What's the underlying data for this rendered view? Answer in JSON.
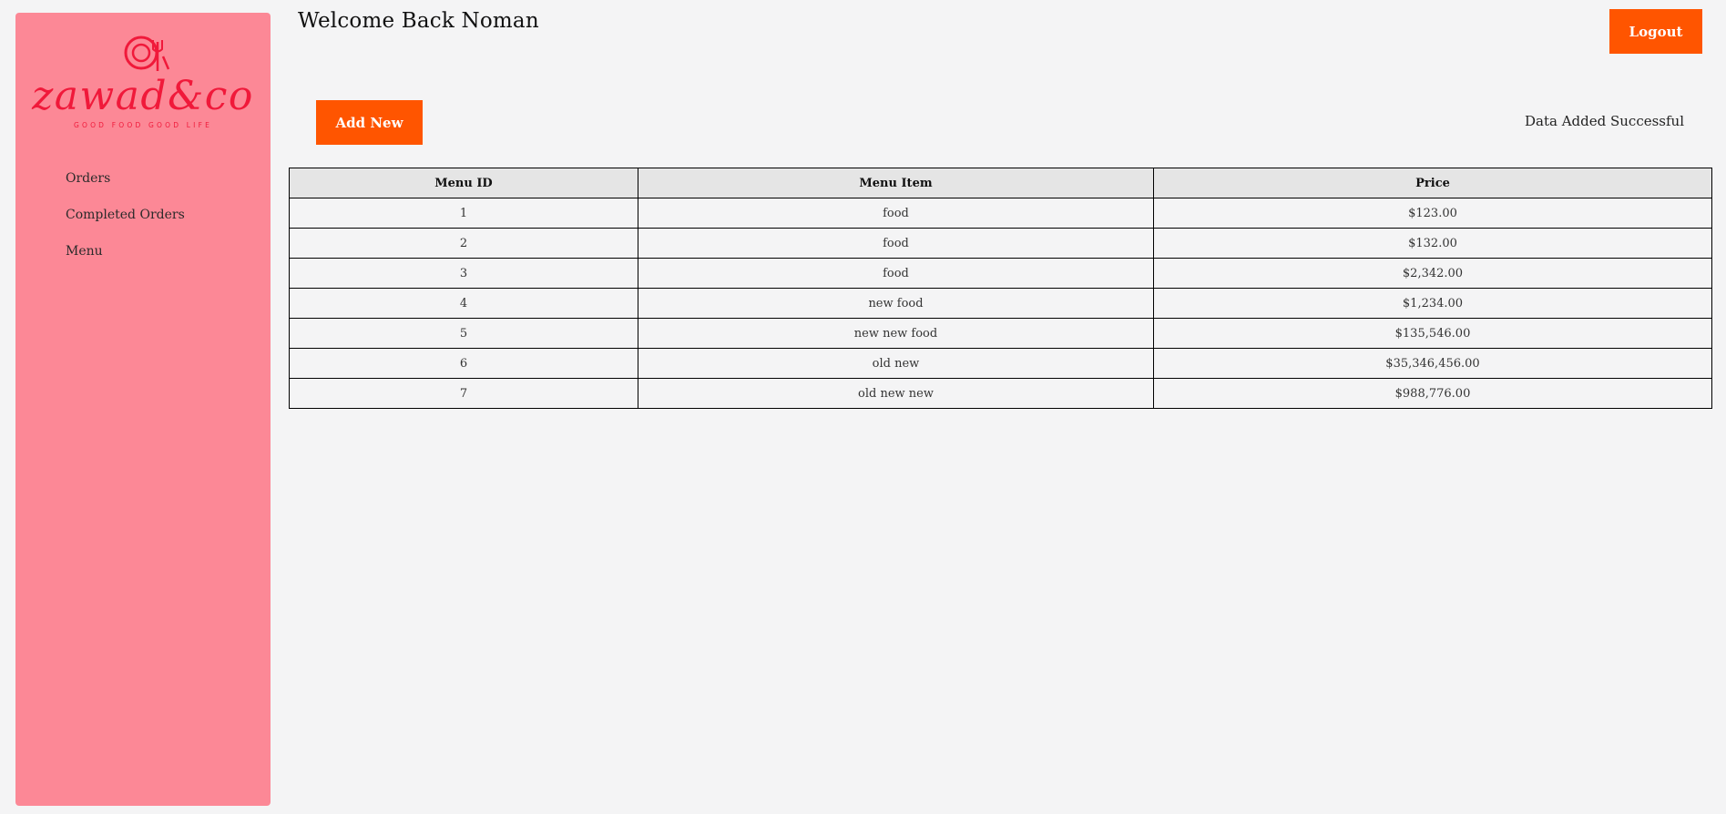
{
  "brand": {
    "name": "zawad&co",
    "tagline": "GOOD FOOD GOOD LIFE",
    "color": "#f0193a"
  },
  "sidebar": {
    "items": [
      {
        "label": "Orders"
      },
      {
        "label": "Completed Orders"
      },
      {
        "label": "Menu"
      }
    ]
  },
  "header": {
    "welcome": "Welcome Back Noman",
    "logout_label": "Logout"
  },
  "toolbar": {
    "add_label": "Add New",
    "status_message": "Data Added Successful"
  },
  "table": {
    "headers": [
      "Menu ID",
      "Menu Item",
      "Price"
    ],
    "rows": [
      [
        "1",
        "food",
        "$123.00"
      ],
      [
        "2",
        "food",
        "$132.00"
      ],
      [
        "3",
        "food",
        "$2,342.00"
      ],
      [
        "4",
        "new food",
        "$1,234.00"
      ],
      [
        "5",
        "new new food",
        "$135,546.00"
      ],
      [
        "6",
        "old new",
        "$35,346,456.00"
      ],
      [
        "7",
        "old new new",
        "$988,776.00"
      ]
    ]
  },
  "colors": {
    "sidebar_bg": "#fc8896",
    "accent": "#ff5500",
    "page_bg": "#f4f4f5",
    "table_header_bg": "#e5e5e5"
  }
}
